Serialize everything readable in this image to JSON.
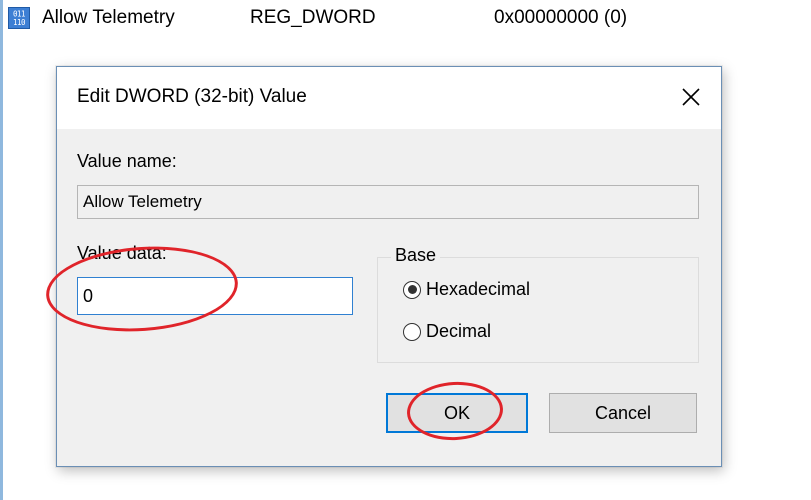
{
  "registry_row": {
    "name": "Allow Telemetry",
    "type": "REG_DWORD",
    "data": "0x00000000 (0)",
    "icon": "registry-binary-value-icon",
    "icon_glyph": "011\n110"
  },
  "dialog": {
    "title": "Edit DWORD (32-bit) Value",
    "close_glyph": "✕",
    "value_name_label": "Value name:",
    "value_name": "Allow Telemetry",
    "value_data_label": "Value data:",
    "value_data": "0",
    "base_label": "Base",
    "base_options": [
      {
        "label": "Hexadecimal",
        "selected": true
      },
      {
        "label": "Decimal",
        "selected": false
      }
    ],
    "ok_label": "OK",
    "cancel_label": "Cancel"
  },
  "colors": {
    "dialog_background": "#f0f0f0",
    "titlebar_background": "#ffffff",
    "focus_accent": "#0078d7",
    "annotation": "#e0242a"
  }
}
